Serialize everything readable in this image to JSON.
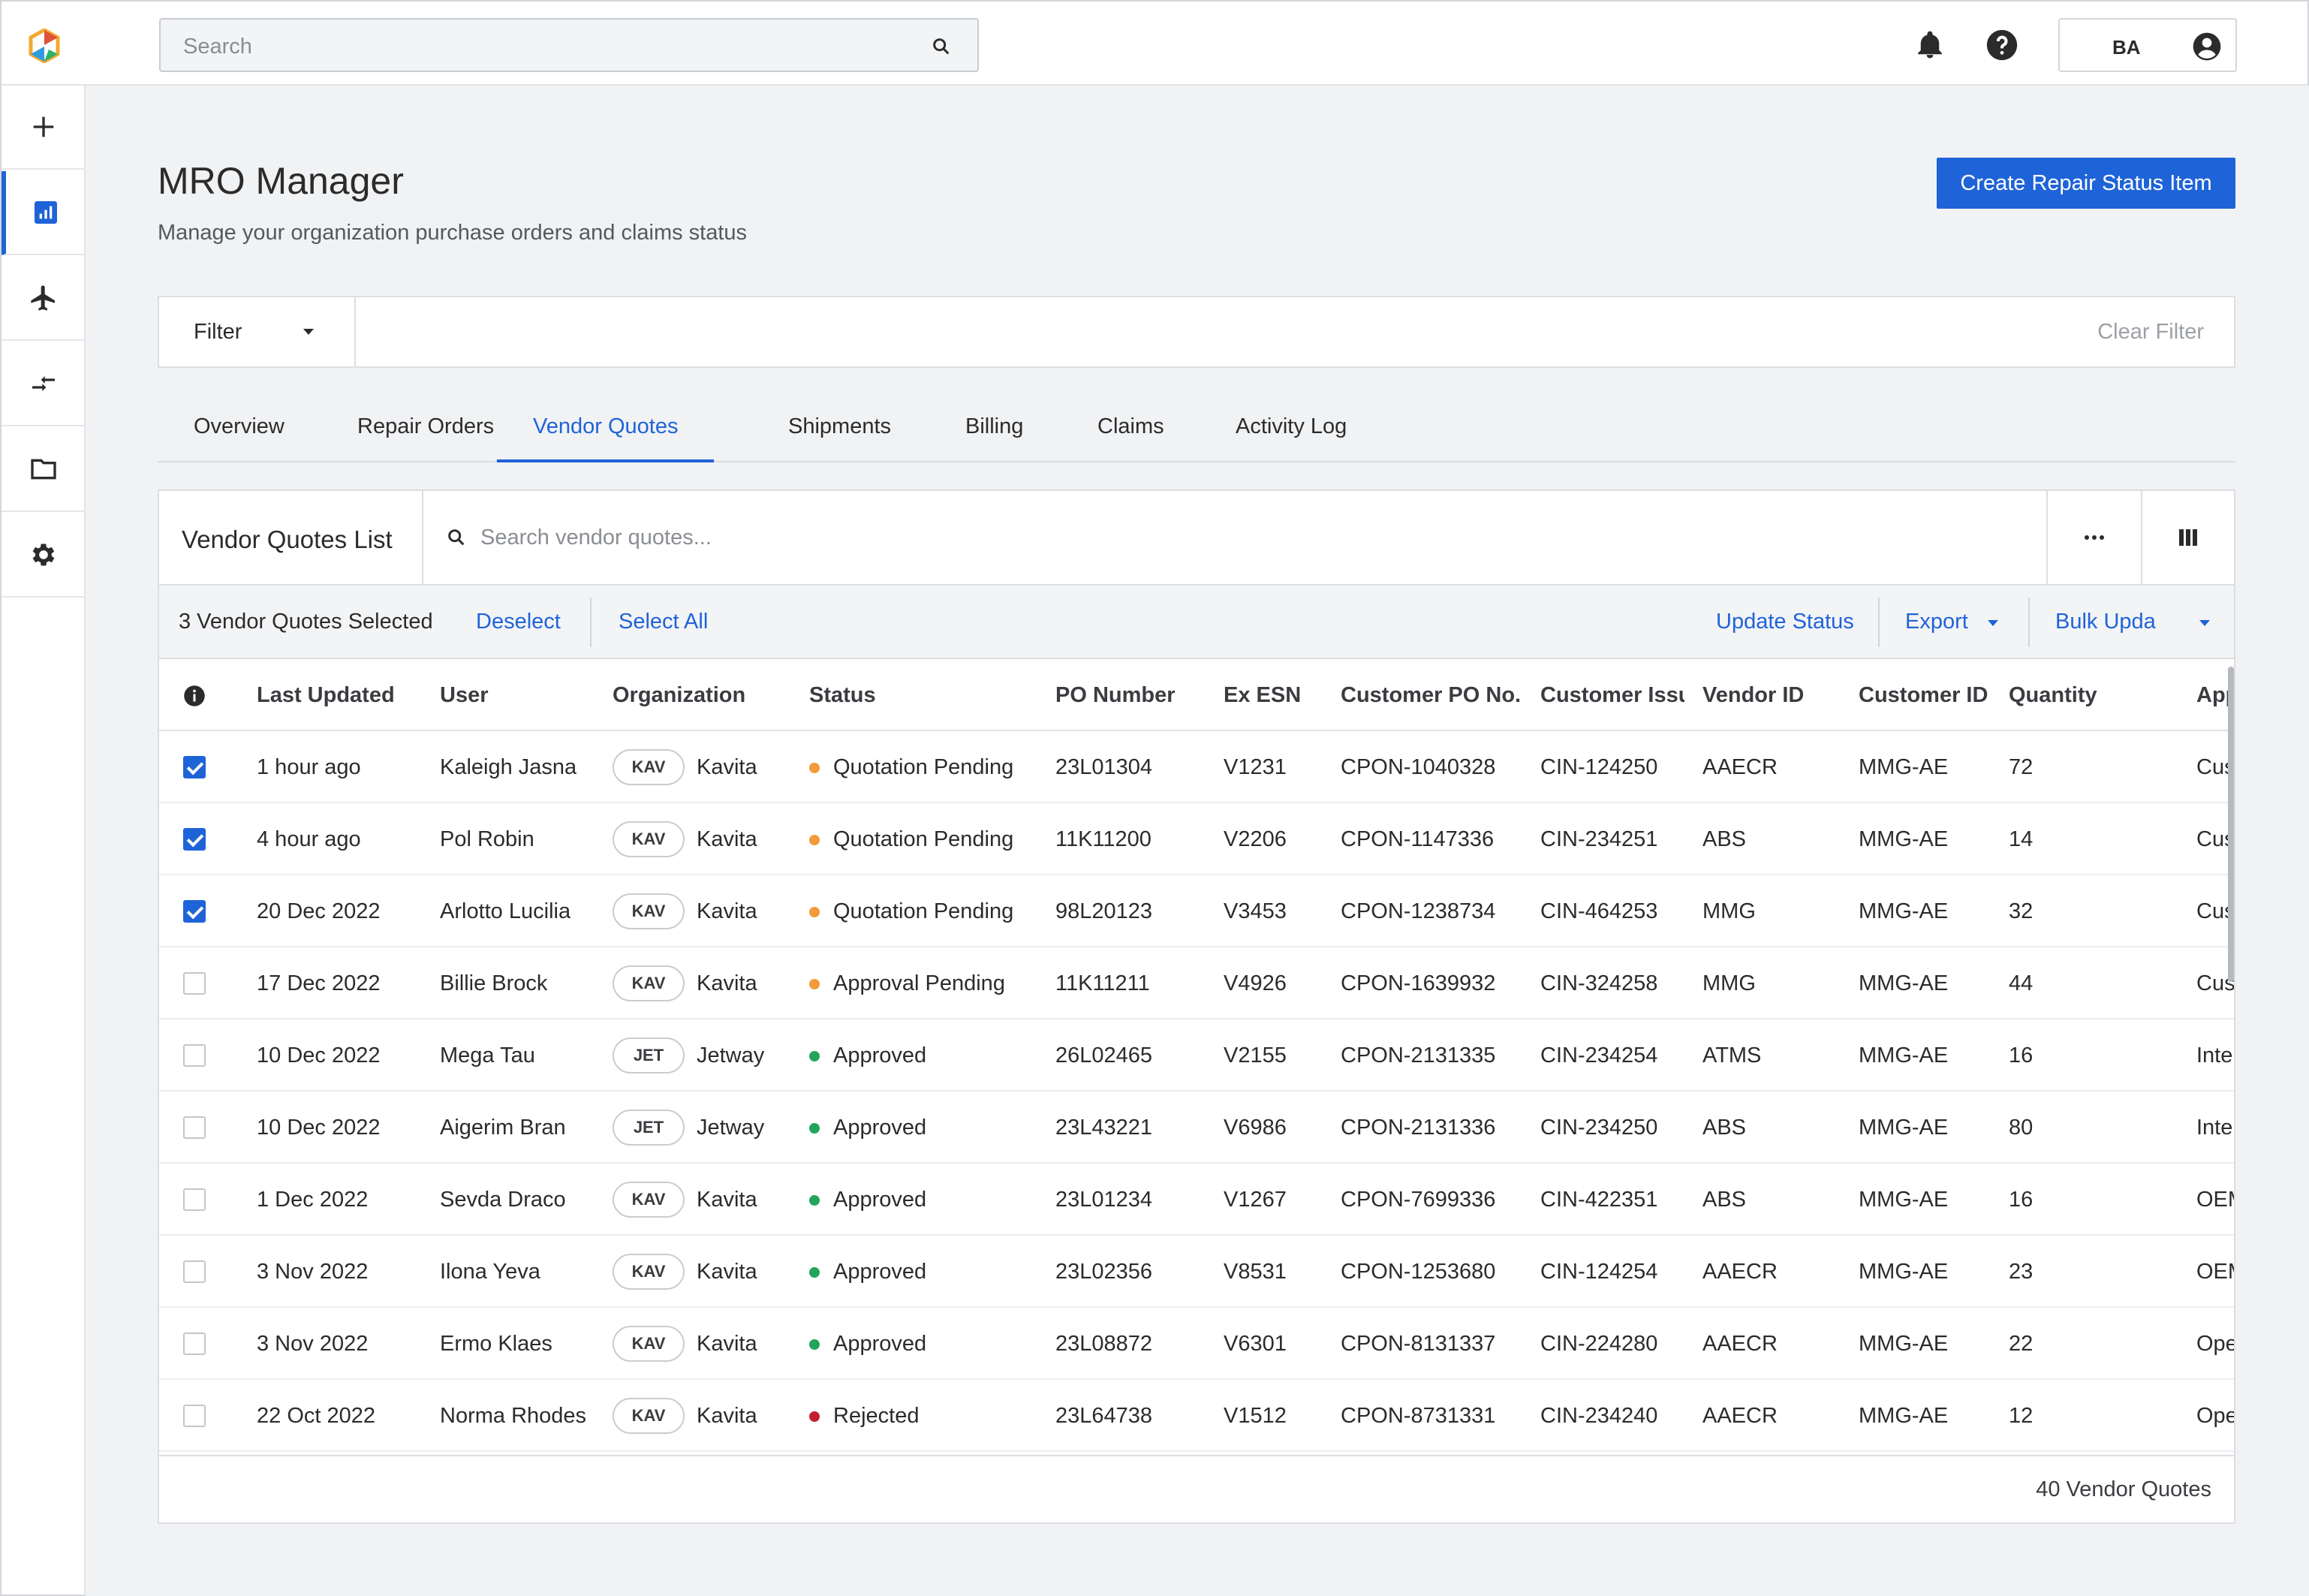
{
  "topbar": {
    "search_placeholder": "Search",
    "user_initials": "BA"
  },
  "sidebar": {
    "items": [
      {
        "icon": "plus-icon"
      },
      {
        "icon": "chart-icon",
        "active": true
      },
      {
        "icon": "airplane-icon"
      },
      {
        "icon": "transfer-icon"
      },
      {
        "icon": "folder-icon"
      },
      {
        "icon": "gear-icon"
      }
    ]
  },
  "header": {
    "title": "MRO Manager",
    "subtitle": "Manage your organization purchase orders and claims status",
    "create_label": "Create Repair Status Item"
  },
  "filter": {
    "label": "Filter",
    "clear_label": "Clear Filter"
  },
  "tabs": [
    "Overview",
    "Repair Orders",
    "Vendor Quotes",
    "Shipments",
    "Billing",
    "Claims",
    "Activity Log"
  ],
  "active_tab": "Vendor Quotes",
  "list": {
    "title": "Vendor Quotes List",
    "search_placeholder": "Search vendor quotes...",
    "more_label": "···"
  },
  "selection": {
    "count_text": "3 Vendor Quotes Selected",
    "deselect": "Deselect",
    "select_all": "Select All",
    "update_status": "Update Status",
    "export": "Export",
    "bulk_update": "Bulk Upda"
  },
  "table": {
    "columns": [
      "Last Updated",
      "User",
      "Organization",
      "Status",
      "PO Number",
      "Ex ESN",
      "Customer PO No.",
      "Customer Issu",
      "Vendor ID",
      "Customer ID",
      "Quantity",
      "App"
    ],
    "rows": [
      {
        "checked": true,
        "updated": "1 hour ago",
        "user": "Kaleigh Jasna",
        "org_code": "KAV",
        "org": "Kavita",
        "status": "Quotation Pending",
        "status_color": "#f39a3b",
        "po": "23L01304",
        "esn": "V1231",
        "cpo": "CPON-1040328",
        "cissue": "CIN-124250",
        "vendor": "AAECR",
        "cust": "MMG-AE",
        "qty": "72",
        "app": "Cust"
      },
      {
        "checked": true,
        "updated": "4 hour ago",
        "user": "Pol Robin",
        "org_code": "KAV",
        "org": "Kavita",
        "status": "Quotation Pending",
        "status_color": "#f39a3b",
        "po": "11K11200",
        "esn": "V2206",
        "cpo": "CPON-1147336",
        "cissue": "CIN-234251",
        "vendor": "ABS",
        "cust": "MMG-AE",
        "qty": "14",
        "app": "Cust"
      },
      {
        "checked": true,
        "updated": "20 Dec 2022",
        "user": "Arlotto Lucilia",
        "org_code": "KAV",
        "org": "Kavita",
        "status": "Quotation Pending",
        "status_color": "#f39a3b",
        "po": "98L20123",
        "esn": "V3453",
        "cpo": "CPON-1238734",
        "cissue": "CIN-464253",
        "vendor": "MMG",
        "cust": "MMG-AE",
        "qty": "32",
        "app": "Cust"
      },
      {
        "checked": false,
        "updated": "17 Dec 2022",
        "user": "Billie Brock",
        "org_code": "KAV",
        "org": "Kavita",
        "status": "Approval Pending",
        "status_color": "#f39a3b",
        "po": "11K11211",
        "esn": "V4926",
        "cpo": "CPON-1639932",
        "cissue": "CIN-324258",
        "vendor": "MMG",
        "cust": "MMG-AE",
        "qty": "44",
        "app": "Cust"
      },
      {
        "checked": false,
        "updated": "10 Dec 2022",
        "user": "Mega Tau",
        "org_code": "JET",
        "org": "Jetway",
        "status": "Approved",
        "status_color": "#22a55b",
        "po": "26L02465",
        "esn": "V2155",
        "cpo": "CPON-2131335",
        "cissue": "CIN-234254",
        "vendor": "ATMS",
        "cust": "MMG-AE",
        "qty": "16",
        "app": "Inte"
      },
      {
        "checked": false,
        "updated": "10 Dec 2022",
        "user": "Aigerim Bran",
        "org_code": "JET",
        "org": "Jetway",
        "status": "Approved",
        "status_color": "#22a55b",
        "po": "23L43221",
        "esn": "V6986",
        "cpo": "CPON-2131336",
        "cissue": "CIN-234250",
        "vendor": "ABS",
        "cust": "MMG-AE",
        "qty": "80",
        "app": "Inte"
      },
      {
        "checked": false,
        "updated": "1 Dec 2022",
        "user": "Sevda Draco",
        "org_code": "KAV",
        "org": "Kavita",
        "status": "Approved",
        "status_color": "#22a55b",
        "po": "23L01234",
        "esn": "V1267",
        "cpo": "CPON-7699336",
        "cissue": "CIN-422351",
        "vendor": "ABS",
        "cust": "MMG-AE",
        "qty": "16",
        "app": "OEM"
      },
      {
        "checked": false,
        "updated": "3 Nov 2022",
        "user": "Ilona Yeva",
        "org_code": "KAV",
        "org": "Kavita",
        "status": "Approved",
        "status_color": "#22a55b",
        "po": "23L02356",
        "esn": "V8531",
        "cpo": "CPON-1253680",
        "cissue": "CIN-124254",
        "vendor": "AAECR",
        "cust": "MMG-AE",
        "qty": "23",
        "app": "OEM"
      },
      {
        "checked": false,
        "updated": "3 Nov 2022",
        "user": "Ermo Klaes",
        "org_code": "KAV",
        "org": "Kavita",
        "status": "Approved",
        "status_color": "#22a55b",
        "po": "23L08872",
        "esn": "V6301",
        "cpo": "CPON-8131337",
        "cissue": "CIN-224280",
        "vendor": "AAECR",
        "cust": "MMG-AE",
        "qty": "22",
        "app": "Ope"
      },
      {
        "checked": false,
        "updated": "22 Oct 2022",
        "user": "Norma Rhodes",
        "org_code": "KAV",
        "org": "Kavita",
        "status": "Rejected",
        "status_color": "#c41f2f",
        "po": "23L64738",
        "esn": "V1512",
        "cpo": "CPON-8731331",
        "cissue": "CIN-234240",
        "vendor": "AAECR",
        "cust": "MMG-AE",
        "qty": "12",
        "app": "Ope"
      }
    ]
  },
  "footer": {
    "total_text": "40 Vendor Quotes"
  },
  "colors": {
    "accent": "#1f63d8",
    "pending": "#f39a3b",
    "approved": "#22a55b",
    "rejected": "#c41f2f"
  }
}
